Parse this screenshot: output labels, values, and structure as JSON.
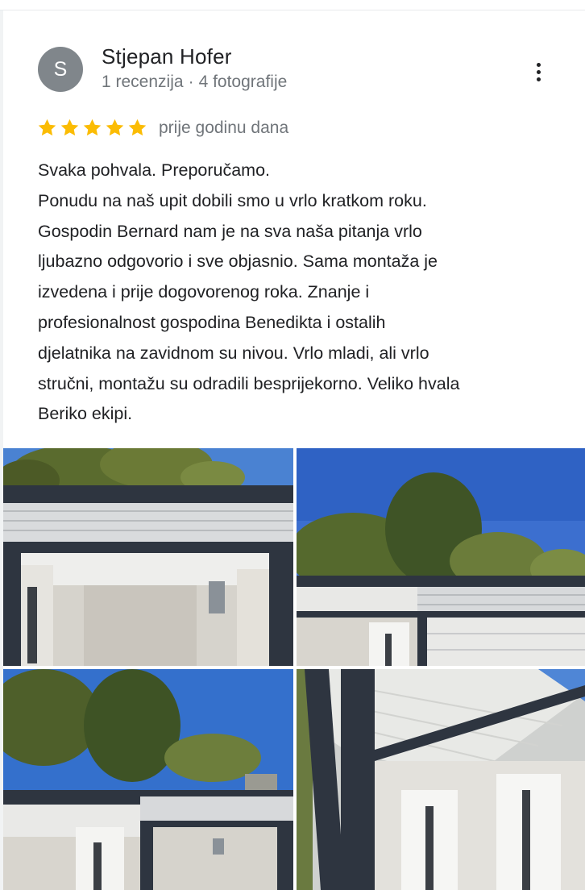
{
  "review": {
    "author": {
      "initial": "S",
      "name": "Stjepan Hofer",
      "reviews_count": "1 recenzija",
      "separator": "·",
      "photos_count": "4 fotografije"
    },
    "rating": 5,
    "rating_max": 5,
    "time_ago": "prije godinu dana",
    "text_lines": [
      "Svaka pohvala. Preporučamo.",
      "Ponudu na naš upit dobili smo u vrlo kratkom roku.",
      "Gospodin Bernard nam je na sva naša pitanja vrlo",
      "ljubazno odgovorio i sve objasnio. Sama montaža je",
      "izvedena i prije dogovorenog roka. Znanje i",
      "profesionalnost gospodina Benedikta i ostalih",
      "djelatnika na zavidnom su nivou. Vrlo mladi, ali vrlo",
      "stručni, montažu su odradili besprijekorno. Veliko hvala",
      "Beriko ekipi."
    ]
  },
  "colors": {
    "star": "#fbbc04",
    "avatar_bg": "#80868b",
    "text_primary": "#202124",
    "text_secondary": "#70757a"
  },
  "icons": {
    "menu": "more-vert-icon",
    "star": "star-icon"
  }
}
